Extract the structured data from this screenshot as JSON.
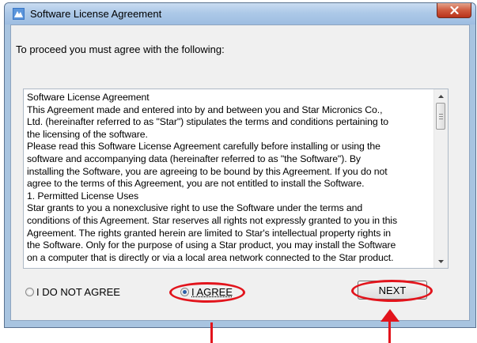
{
  "window": {
    "title": "Software License Agreement",
    "close_label": "x"
  },
  "prompt": "To proceed you must agree with the following:",
  "license_lines": [
    "Software License Agreement",
    "This Agreement made and entered into by and between you and Star Micronics Co.,",
    "Ltd. (hereinafter referred to as \"Star\") stipulates the terms and conditions pertaining to",
    "the licensing of the software.",
    "Please read this Software License Agreement carefully before installing or using the",
    "software and accompanying data (hereinafter referred to as \"the Software\"). By",
    "installing the Software, you are agreeing to be bound by this Agreement. If you do not",
    "agree to the terms of this Agreement, you are not entitled to install the Software.",
    "1. Permitted License Uses",
    "Star grants to you a nonexclusive right to use the Software under the terms and",
    "conditions of this Agreement. Star reserves all rights not expressly granted to you in this",
    "Agreement. The rights granted herein are limited to Star's intellectual property rights in",
    "the Software. Only for the purpose of using a Star product, you may install the Software",
    "on a computer that is directly or via a local area network connected to the Star product."
  ],
  "options": {
    "disagree_label": "I DO NOT AGREE",
    "agree_label": "I AGREE",
    "selected": "agree"
  },
  "next_label": "NEXT",
  "colors": {
    "highlight": "#e2141c",
    "radio_dot": "#2d5fa8"
  }
}
